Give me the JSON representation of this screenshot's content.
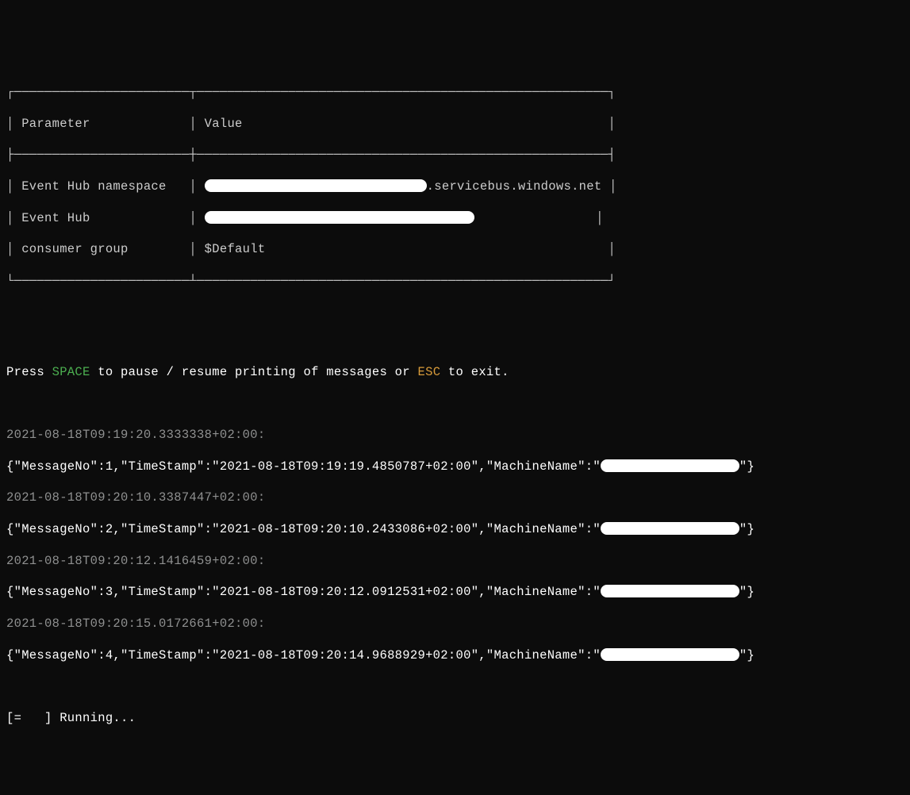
{
  "table": {
    "headers": {
      "col1": "Parameter",
      "col2": "Value"
    },
    "rows": [
      {
        "name": "Event Hub namespace",
        "value_visible_suffix": ".servicebus.windows.net"
      },
      {
        "name": "Event Hub",
        "value_visible_suffix": ""
      },
      {
        "name": "consumer group",
        "value_visible_suffix": "$Default"
      }
    ]
  },
  "instruction": {
    "prefix": "Press ",
    "space": "SPACE",
    "mid": " to pause / resume printing of messages or ",
    "esc": "ESC",
    "suffix": " to exit."
  },
  "logs": [
    {
      "ts": "2021-08-18T09:19:20.3333338+02:00:",
      "prefix": "{\"MessageNo\":1,\"TimeStamp\":\"2021-08-18T09:19:19.4850787+02:00\",\"MachineName\":\"",
      "suffix": "\"}"
    },
    {
      "ts": "2021-08-18T09:20:10.3387447+02:00:",
      "prefix": "{\"MessageNo\":2,\"TimeStamp\":\"2021-08-18T09:20:10.2433086+02:00\",\"MachineName\":\"",
      "suffix": "\"}"
    },
    {
      "ts": "2021-08-18T09:20:12.1416459+02:00:",
      "prefix": "{\"MessageNo\":3,\"TimeStamp\":\"2021-08-18T09:20:12.0912531+02:00\",\"MachineName\":\"",
      "suffix": "\"}"
    },
    {
      "ts": "2021-08-18T09:20:15.0172661+02:00:",
      "prefix": "{\"MessageNo\":4,\"TimeStamp\":\"2021-08-18T09:20:14.9688929+02:00\",\"MachineName\":\"",
      "suffix": "\"}"
    }
  ],
  "spinner": {
    "frame": "[=   ]",
    "text": " Running..."
  },
  "box": {
    "top": "┌───────────────────────┬──────────────────────────────────────────────────────┐",
    "hdrL": "│ ",
    "hdrSep": "             │ ",
    "hdrEnd": "                                                │",
    "mid": "├───────────────────────┼──────────────────────────────────────────────────────┤",
    "r1L": "│ ",
    "r1Sep": "   │ ",
    "r1End": " │",
    "r2L": "│ ",
    "r2Sep": "             │ ",
    "r2End": "                │",
    "r3L": "│ ",
    "r3Sep": "        │ ",
    "r3End": "                                             │",
    "bot": "└───────────────────────┴──────────────────────────────────────────────────────┘"
  }
}
